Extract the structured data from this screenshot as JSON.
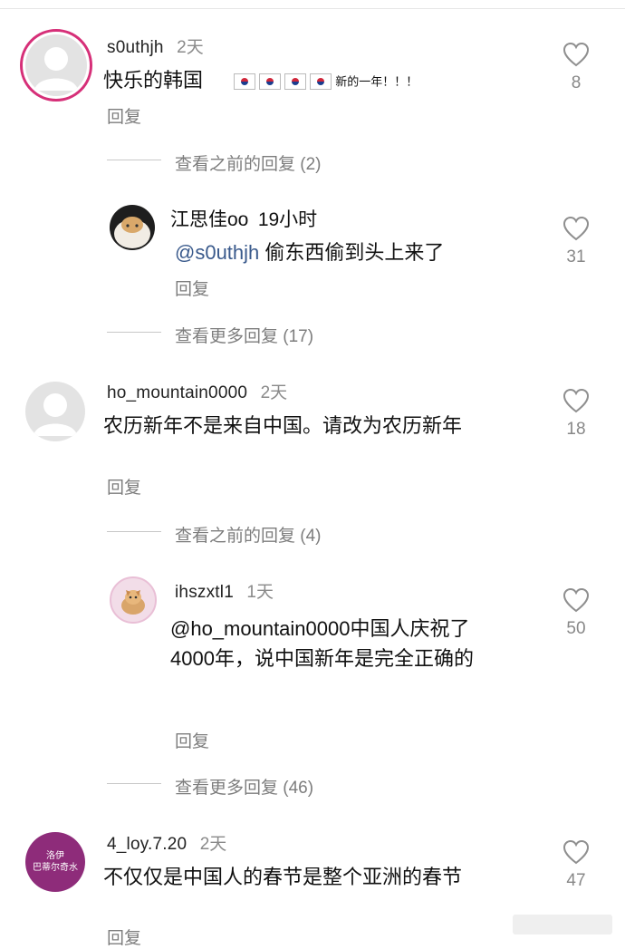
{
  "comments": [
    {
      "username": "s0uthjh",
      "time": "2天",
      "text": "快乐的韩国",
      "sticker_text": "新的一年！！！",
      "reply_label": "回复",
      "likes": "8",
      "view_previous": "查看之前的回复 (2)",
      "replies": [
        {
          "username": "江思佳oo",
          "time": "19小时",
          "mention": "@s0uthjh",
          "text": "偷东西偷到头上来了",
          "reply_label": "回复",
          "likes": "31"
        }
      ],
      "view_more": "查看更多回复 (17)"
    },
    {
      "username": "ho_mountain0000",
      "time": "2天",
      "text": "农历新年不是来自中国。请改为农历新年",
      "reply_label": "回复",
      "likes": "18",
      "view_previous": "查看之前的回复 (4)",
      "replies": [
        {
          "username": "ihszxtl1",
          "time": "1天",
          "mention": "@ho_mountain0000",
          "text_line1": "中国人庆祝了",
          "text_line2": "4000年，说中国新年是完全正确的",
          "reply_label": "回复",
          "likes": "50"
        }
      ],
      "view_more": "查看更多回复 (46)"
    },
    {
      "username": "4_loy.7.20",
      "time": "2天",
      "avatar_text_line1": "洛伊",
      "avatar_text_line2": "巴蒂尔奇水",
      "text": "不仅仅是中国人的春节是整个亚洲的春节",
      "reply_label": "回复",
      "likes": "47"
    }
  ]
}
